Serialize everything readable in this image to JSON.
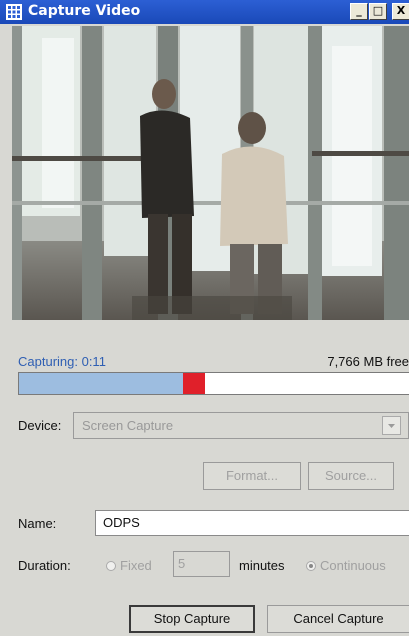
{
  "window": {
    "title": "Capture Video",
    "minimize_label": "_",
    "maximize_label": "□",
    "close_label": "X"
  },
  "status": {
    "capturing": "Capturing: 0:11",
    "free_space": "7,766 MB free"
  },
  "progress": {
    "level_percent": 42,
    "marker_color": "#e0202a",
    "fill_color": "#9dbde0"
  },
  "device": {
    "label": "Device:",
    "value": "Screen Capture"
  },
  "buttons": {
    "format": "Format...",
    "source": "Source...",
    "stop": "Stop Capture",
    "cancel": "Cancel Capture"
  },
  "name": {
    "label": "Name:",
    "value": "ODPS"
  },
  "duration": {
    "label": "Duration:",
    "fixed_label": "Fixed",
    "minutes_value": "5",
    "minutes_label": "minutes",
    "continuous_label": "Continuous",
    "selected": "Continuous"
  },
  "colors": {
    "titlebar": "#2c5fd4",
    "status_text": "#2f5fb3"
  },
  "icons": {
    "app": "capture-video-app-icon",
    "dropdown": "chevron-down-icon"
  }
}
